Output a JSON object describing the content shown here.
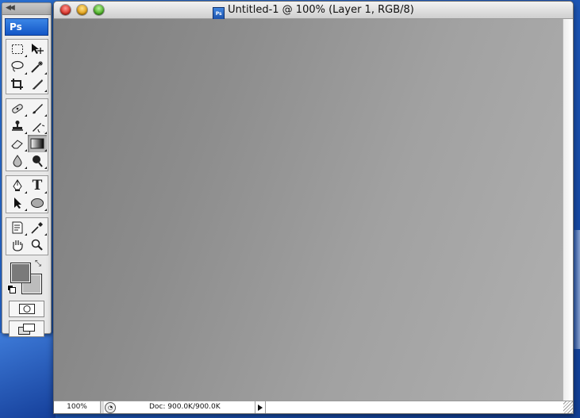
{
  "tools_palette": {
    "logo_label": "Ps",
    "groups": [
      [
        "rectangular-marquee-tool",
        "move-tool",
        "lasso-tool",
        "magic-wand-tool",
        "crop-tool",
        "slice-tool"
      ],
      [
        "healing-brush-tool",
        "brush-tool",
        "clone-stamp-tool",
        "history-brush-tool",
        "eraser-tool",
        "gradient-tool",
        "blur-tool",
        "dodge-tool"
      ],
      [
        "pen-tool",
        "type-tool",
        "path-selection-tool",
        "ellipse-tool"
      ],
      [
        "notes-tool",
        "eyedropper-tool",
        "hand-tool",
        "zoom-tool"
      ]
    ],
    "selected_tool": "gradient-tool",
    "type_tool_glyph": "T",
    "foreground_color": "#7a7a7a",
    "background_color": "#bcbcbc"
  },
  "document": {
    "title": "Untitled-1 @ 100% (Layer 1, RGB/8)",
    "icon_label": "Ps",
    "status": {
      "zoom": "100%",
      "doc_info": "Doc: 900.0K/900.0K"
    }
  }
}
